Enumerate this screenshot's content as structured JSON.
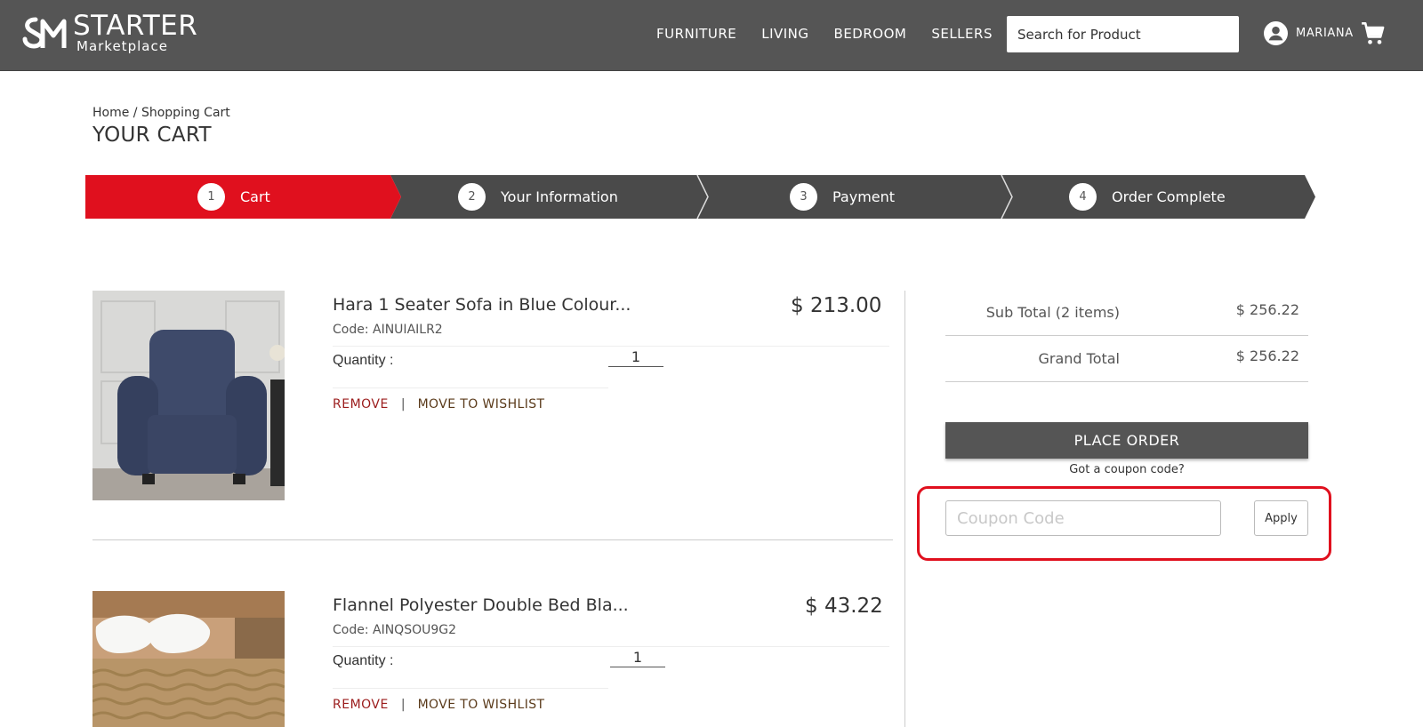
{
  "brand": {
    "title": "STARTER",
    "subtitle": "Marketplace",
    "logo_icon": "sm-monogram-icon"
  },
  "nav": {
    "items": [
      {
        "label": "FURNITURE"
      },
      {
        "label": "LIVING"
      },
      {
        "label": "BEDROOM"
      },
      {
        "label": "SELLERS"
      }
    ]
  },
  "search": {
    "placeholder": "Search for Product"
  },
  "user": {
    "name": "MARIANA",
    "icon": "account-circle-icon"
  },
  "header_cart": {
    "icon": "shopping-cart-icon"
  },
  "breadcrumb": {
    "home": "Home",
    "separator": " / ",
    "current": "Shopping Cart"
  },
  "page_title": "YOUR CART",
  "steps": [
    {
      "num": "1",
      "label": "Cart"
    },
    {
      "num": "2",
      "label": "Your Information"
    },
    {
      "num": "3",
      "label": "Payment"
    },
    {
      "num": "4",
      "label": "Order Complete"
    }
  ],
  "cart_items": [
    {
      "name": "Hara 1 Seater Sofa in Blue Colour...",
      "code": "Code: AINUIAILR2",
      "price": "$ 213.00",
      "quantity_label": "Quantity :",
      "quantity": "1",
      "remove_label": "REMOVE",
      "separator": "|",
      "wishlist_label": "MOVE TO WISHLIST"
    },
    {
      "name": "Flannel Polyester Double Bed Bla...",
      "code": "Code: AINQSOU9G2",
      "price": "$ 43.22",
      "quantity_label": "Quantity :",
      "quantity": "1",
      "remove_label": "REMOVE",
      "separator": "|",
      "wishlist_label": "MOVE TO WISHLIST"
    }
  ],
  "summary": {
    "subtotal_label": "Sub Total (2 items)",
    "subtotal_value": "$ 256.22",
    "grand_total_label": "Grand Total",
    "grand_total_value": "$ 256.22",
    "place_order_label": "PLACE ORDER",
    "coupon_question": "Got a coupon code?",
    "coupon_placeholder": "Coupon Code",
    "apply_label": "Apply"
  },
  "colors": {
    "header_bg": "#555555",
    "active_step": "#e0101e",
    "step_bg": "#4a4a4a",
    "highlight_border": "#e0101e",
    "remove_text": "#9b1c1c"
  }
}
